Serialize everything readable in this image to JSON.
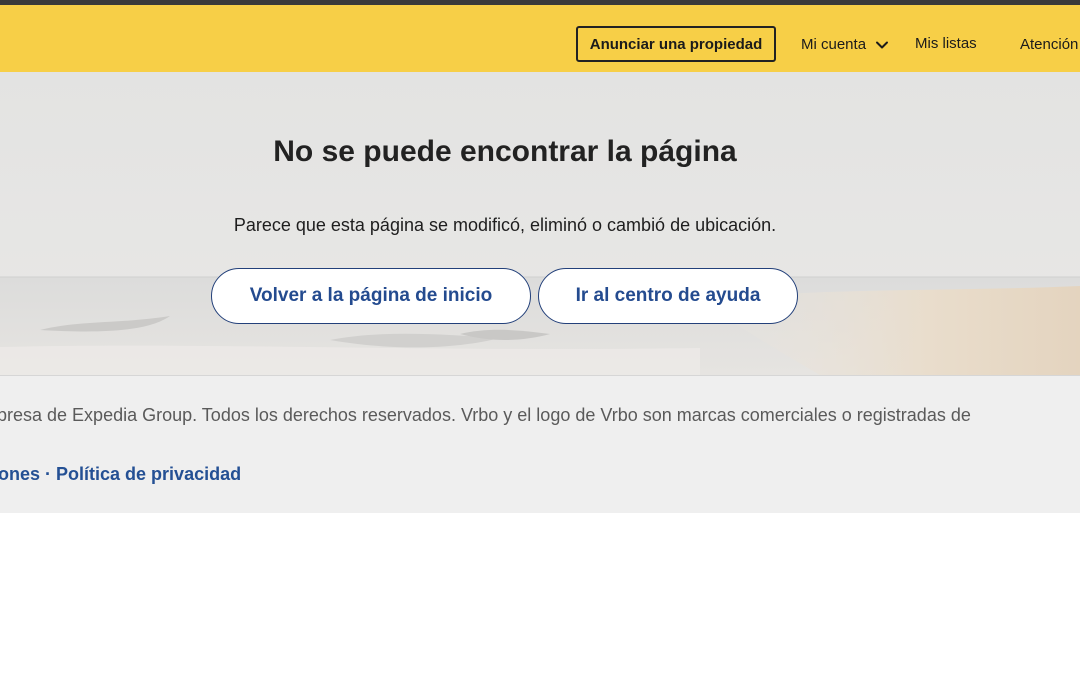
{
  "header": {
    "list_property_label": "Anunciar una propiedad",
    "account_label": "Mi cuenta",
    "lists_label": "Mis listas",
    "help_label": "Atención"
  },
  "main": {
    "title": "No se puede encontrar la página",
    "message": "Parece que esta página se modificó, eliminó o cambió de ubicación.",
    "home_button": "Volver a la página de inicio",
    "help_button": "Ir al centro de ayuda"
  },
  "footer": {
    "legal_text": "presa de Expedia Group. Todos los derechos reservados. Vrbo y el logo de Vrbo son marcas comerciales o registradas de",
    "links": {
      "terms": "ones",
      "separator": "·",
      "privacy": "Política de privacidad"
    }
  },
  "colors": {
    "header_bg": "#f7cf47",
    "link_blue": "#245094",
    "footer_bg": "#efefef"
  },
  "icons": {
    "account_dropdown": "chevron-down-icon"
  }
}
